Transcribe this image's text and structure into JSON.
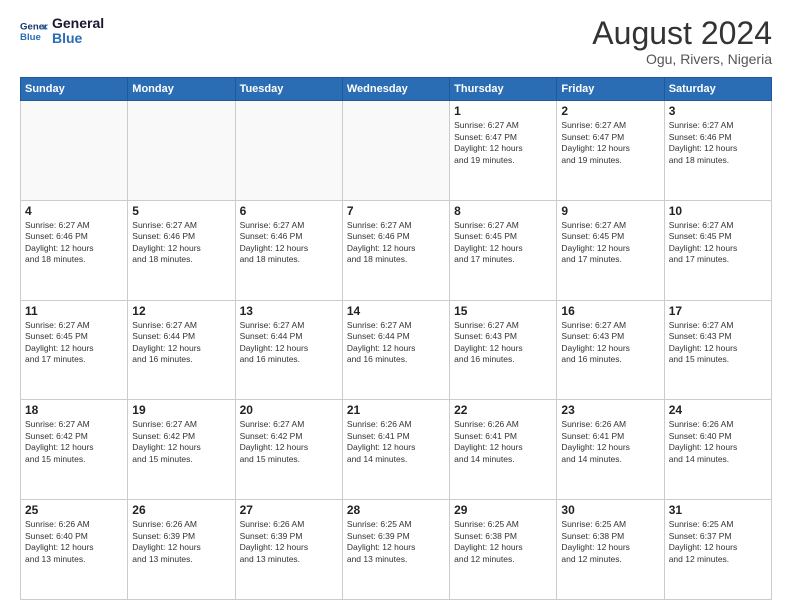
{
  "header": {
    "logo_line1": "General",
    "logo_line2": "Blue",
    "month_year": "August 2024",
    "location": "Ogu, Rivers, Nigeria"
  },
  "weekdays": [
    "Sunday",
    "Monday",
    "Tuesday",
    "Wednesday",
    "Thursday",
    "Friday",
    "Saturday"
  ],
  "weeks": [
    [
      {
        "day": "",
        "info": ""
      },
      {
        "day": "",
        "info": ""
      },
      {
        "day": "",
        "info": ""
      },
      {
        "day": "",
        "info": ""
      },
      {
        "day": "1",
        "info": "Sunrise: 6:27 AM\nSunset: 6:47 PM\nDaylight: 12 hours\nand 19 minutes."
      },
      {
        "day": "2",
        "info": "Sunrise: 6:27 AM\nSunset: 6:47 PM\nDaylight: 12 hours\nand 19 minutes."
      },
      {
        "day": "3",
        "info": "Sunrise: 6:27 AM\nSunset: 6:46 PM\nDaylight: 12 hours\nand 18 minutes."
      }
    ],
    [
      {
        "day": "4",
        "info": "Sunrise: 6:27 AM\nSunset: 6:46 PM\nDaylight: 12 hours\nand 18 minutes."
      },
      {
        "day": "5",
        "info": "Sunrise: 6:27 AM\nSunset: 6:46 PM\nDaylight: 12 hours\nand 18 minutes."
      },
      {
        "day": "6",
        "info": "Sunrise: 6:27 AM\nSunset: 6:46 PM\nDaylight: 12 hours\nand 18 minutes."
      },
      {
        "day": "7",
        "info": "Sunrise: 6:27 AM\nSunset: 6:46 PM\nDaylight: 12 hours\nand 18 minutes."
      },
      {
        "day": "8",
        "info": "Sunrise: 6:27 AM\nSunset: 6:45 PM\nDaylight: 12 hours\nand 17 minutes."
      },
      {
        "day": "9",
        "info": "Sunrise: 6:27 AM\nSunset: 6:45 PM\nDaylight: 12 hours\nand 17 minutes."
      },
      {
        "day": "10",
        "info": "Sunrise: 6:27 AM\nSunset: 6:45 PM\nDaylight: 12 hours\nand 17 minutes."
      }
    ],
    [
      {
        "day": "11",
        "info": "Sunrise: 6:27 AM\nSunset: 6:45 PM\nDaylight: 12 hours\nand 17 minutes."
      },
      {
        "day": "12",
        "info": "Sunrise: 6:27 AM\nSunset: 6:44 PM\nDaylight: 12 hours\nand 16 minutes."
      },
      {
        "day": "13",
        "info": "Sunrise: 6:27 AM\nSunset: 6:44 PM\nDaylight: 12 hours\nand 16 minutes."
      },
      {
        "day": "14",
        "info": "Sunrise: 6:27 AM\nSunset: 6:44 PM\nDaylight: 12 hours\nand 16 minutes."
      },
      {
        "day": "15",
        "info": "Sunrise: 6:27 AM\nSunset: 6:43 PM\nDaylight: 12 hours\nand 16 minutes."
      },
      {
        "day": "16",
        "info": "Sunrise: 6:27 AM\nSunset: 6:43 PM\nDaylight: 12 hours\nand 16 minutes."
      },
      {
        "day": "17",
        "info": "Sunrise: 6:27 AM\nSunset: 6:43 PM\nDaylight: 12 hours\nand 15 minutes."
      }
    ],
    [
      {
        "day": "18",
        "info": "Sunrise: 6:27 AM\nSunset: 6:42 PM\nDaylight: 12 hours\nand 15 minutes."
      },
      {
        "day": "19",
        "info": "Sunrise: 6:27 AM\nSunset: 6:42 PM\nDaylight: 12 hours\nand 15 minutes."
      },
      {
        "day": "20",
        "info": "Sunrise: 6:27 AM\nSunset: 6:42 PM\nDaylight: 12 hours\nand 15 minutes."
      },
      {
        "day": "21",
        "info": "Sunrise: 6:26 AM\nSunset: 6:41 PM\nDaylight: 12 hours\nand 14 minutes."
      },
      {
        "day": "22",
        "info": "Sunrise: 6:26 AM\nSunset: 6:41 PM\nDaylight: 12 hours\nand 14 minutes."
      },
      {
        "day": "23",
        "info": "Sunrise: 6:26 AM\nSunset: 6:41 PM\nDaylight: 12 hours\nand 14 minutes."
      },
      {
        "day": "24",
        "info": "Sunrise: 6:26 AM\nSunset: 6:40 PM\nDaylight: 12 hours\nand 14 minutes."
      }
    ],
    [
      {
        "day": "25",
        "info": "Sunrise: 6:26 AM\nSunset: 6:40 PM\nDaylight: 12 hours\nand 13 minutes."
      },
      {
        "day": "26",
        "info": "Sunrise: 6:26 AM\nSunset: 6:39 PM\nDaylight: 12 hours\nand 13 minutes."
      },
      {
        "day": "27",
        "info": "Sunrise: 6:26 AM\nSunset: 6:39 PM\nDaylight: 12 hours\nand 13 minutes."
      },
      {
        "day": "28",
        "info": "Sunrise: 6:25 AM\nSunset: 6:39 PM\nDaylight: 12 hours\nand 13 minutes."
      },
      {
        "day": "29",
        "info": "Sunrise: 6:25 AM\nSunset: 6:38 PM\nDaylight: 12 hours\nand 12 minutes."
      },
      {
        "day": "30",
        "info": "Sunrise: 6:25 AM\nSunset: 6:38 PM\nDaylight: 12 hours\nand 12 minutes."
      },
      {
        "day": "31",
        "info": "Sunrise: 6:25 AM\nSunset: 6:37 PM\nDaylight: 12 hours\nand 12 minutes."
      }
    ]
  ]
}
